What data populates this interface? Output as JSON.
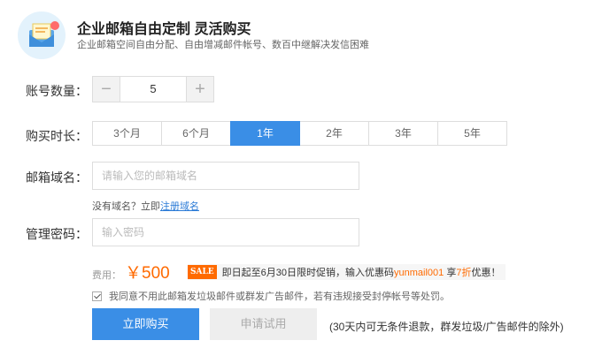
{
  "header": {
    "title": "企业邮箱自由定制 灵活购买",
    "subtitle": "企业邮箱空间自由分配、自由增减邮件帐号、数百中继解决发信困难",
    "icon": "envelope-icon"
  },
  "accounts": {
    "label": "账号数量：",
    "value": "5",
    "minus": "−",
    "plus": "+"
  },
  "duration": {
    "label": "购买时长：",
    "options": [
      "3个月",
      "6个月",
      "1年",
      "2年",
      "3年",
      "5年"
    ],
    "selected": "1年"
  },
  "domain": {
    "label": "邮箱域名：",
    "placeholder": "请输入您的邮箱域名",
    "hint_text": "没有域名？立即",
    "hint_link": "注册域名"
  },
  "password": {
    "label": "管理密码：",
    "placeholder": "输入密码"
  },
  "pricing": {
    "fee_label": "费用：",
    "price": "￥500",
    "sale_tag": "SALE",
    "promo_prefix": "即日起至6月30日限时促销，输入优惠码",
    "promo_code": "yunmail001",
    "promo_mid": " 享",
    "promo_discount": "7折",
    "promo_suffix": "优惠！"
  },
  "agreement": {
    "checked": true,
    "text": "我同意不用此邮箱发垃圾邮件或群发广告邮件，若有违规接受封停帐号等处罚。"
  },
  "actions": {
    "buy": "立即购买",
    "trial": "申请试用",
    "refund_note": "(30天内可无条件退款，群发垃圾/广告邮件的除外)"
  },
  "colors": {
    "primary": "#3a8ee6",
    "accent": "#ff6a00"
  }
}
